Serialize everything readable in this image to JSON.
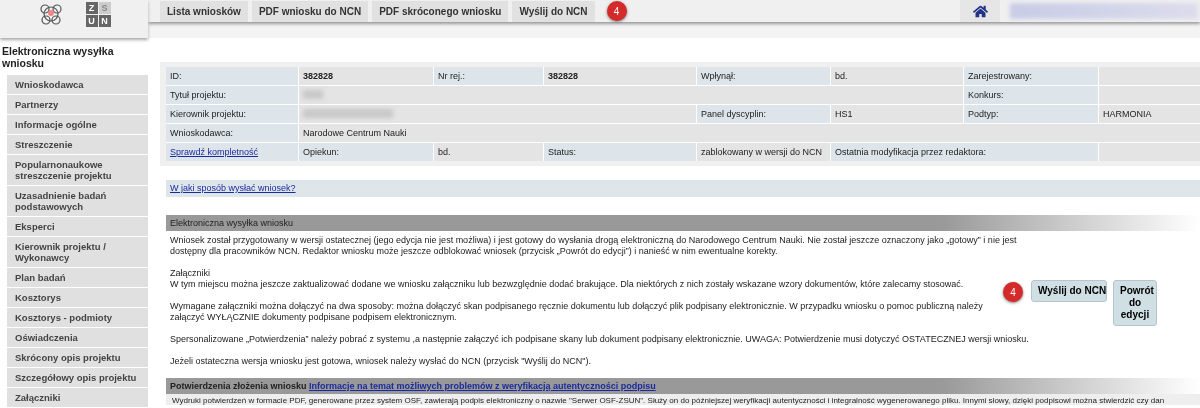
{
  "logo_letters": [
    "Z",
    "S",
    "U",
    "N"
  ],
  "top_tabs": [
    {
      "label": "Lista wniosków"
    },
    {
      "label": "PDF wniosku do NCN"
    },
    {
      "label": "PDF skróconego wniosku"
    },
    {
      "label": "Wyślij do NCN"
    }
  ],
  "top_badge": "4",
  "sidebar": {
    "title": "Elektroniczna wysyłka wniosku",
    "items": [
      "Wnioskodawca",
      "Partnerzy",
      "Informacje ogólne",
      "Streszczenie",
      "Popularnonaukowe streszczenie projektu",
      "Uzasadnienie badań podstawowych",
      "Eksperci",
      "Kierownik projektu / Wykonawcy",
      "Plan badań",
      "Kosztorys",
      "Kosztorys - podmioty",
      "Oświadczenia",
      "Skrócony opis projektu",
      "Szczegółowy opis projektu",
      "Załączniki"
    ]
  },
  "info_table": {
    "rows": [
      {
        "cells": [
          {
            "kind": "label",
            "text": "ID:"
          },
          {
            "kind": "value",
            "text": "382828",
            "bold": true
          },
          {
            "kind": "label",
            "text": "Nr rej.:"
          },
          {
            "kind": "value",
            "text": "382828",
            "bold": true
          },
          {
            "kind": "label",
            "text": "Wpłynął:"
          },
          {
            "kind": "value",
            "text": "bd."
          },
          {
            "kind": "label",
            "text": "Zarejestrowany:"
          },
          {
            "kind": "value"
          }
        ]
      },
      {
        "cells": [
          {
            "kind": "label",
            "text": "Tytuł projektu:"
          },
          {
            "kind": "redacted"
          },
          {
            "kind": "empty"
          },
          {
            "kind": "empty"
          },
          {
            "kind": "empty"
          },
          {
            "kind": "empty"
          },
          {
            "kind": "label",
            "text": "Konkurs:"
          },
          {
            "kind": "value"
          }
        ]
      },
      {
        "cells": [
          {
            "kind": "label",
            "text": "Kierownik projektu:"
          },
          {
            "kind": "redacted"
          },
          {
            "kind": "empty"
          },
          {
            "kind": "empty"
          },
          {
            "kind": "label",
            "text": "Panel dyscyplin:"
          },
          {
            "kind": "value",
            "text": "HS1"
          },
          {
            "kind": "label",
            "text": "Podtyp:"
          },
          {
            "kind": "value",
            "text": "HARMONIA"
          }
        ]
      },
      {
        "cells": [
          {
            "kind": "label",
            "text": "Wnioskodawca:"
          },
          {
            "kind": "value",
            "text": "Narodowe Centrum Nauki"
          },
          {
            "kind": "empty"
          },
          {
            "kind": "empty"
          },
          {
            "kind": "empty"
          },
          {
            "kind": "empty"
          },
          {
            "kind": "empty"
          },
          {
            "kind": "empty"
          }
        ]
      },
      {
        "cells": [
          {
            "kind": "link",
            "text": "Sprawdź kompletność"
          },
          {
            "kind": "label",
            "text": "Opiekun:"
          },
          {
            "kind": "value",
            "text": "bd."
          },
          {
            "kind": "label",
            "text": "Status:"
          },
          {
            "kind": "value",
            "text": "zablokowany w wersji do NCN"
          },
          {
            "kind": "label",
            "text": "Ostatnia modyfikacja przez redaktora:"
          },
          {
            "kind": "empty"
          },
          {
            "kind": "value"
          }
        ]
      }
    ]
  },
  "help_link": "W jaki sposób wysłać wniosek?",
  "send_section": {
    "title": "Elektroniczna wysyłka wniosku",
    "intro": "Wniosek został przygotowany w wersji ostatecznej (jego edycja nie jest możliwa) i jest gotowy do wysłania drogą elektroniczną do Narodowego Centrum Nauki. Nie został jeszcze oznaczony jako „gotowy” i nie jest dostępny dla pracowników NCN. Redaktor wniosku może jeszcze odblokować wniosek (przycisk „Powrót do edycji”) i nanieść w nim ewentualne korekty.",
    "attachments_title": "Załączniki",
    "attachments_text": "W tym miejscu można jeszcze zaktualizować dodane we wniosku załączniku lub bezwzględnie dodać brakujące. Dla niektórych z nich zostały wskazane wzory dokumentów, które zalecamy stosować.",
    "methods_text": "Wymagane załączniki można dołączyć na dwa sposoby: można dołączyć skan podpisanego ręcznie dokumentu lub dołączyć plik podpisany elektronicznie. W przypadku wniosku o pomoc publiczną należy załączyć WYŁĄCZNIE dokumenty podpisane podpisem elektronicznym.",
    "badge": "4",
    "buttons": [
      {
        "label": "Wyślij do NCN"
      },
      {
        "label": "Powrót do edycji"
      }
    ],
    "notes": [
      "Spersonalizowane „Potwierdzenia” należy pobrać z systemu ,a następnie załączyć ich podpisane skany lub dokument podpisany elektronicznie. UWAGA: Potwierdzenie musi dotyczyć OSTATECZNEJ wersji wniosku.",
      "Jeżeli ostateczna wersja wniosku jest gotowa, wniosek należy wysłać do NCN (przycisk \"Wyślij do NCN\")."
    ]
  },
  "confirm_section": {
    "title": "Potwierdzenia złożenia wniosku",
    "link": "Informacje na temat możliwych problemów z weryfikacją autentyczności podpisu",
    "text": "Wydruki potwierdzeń w formacie PDF, generowane przez system OSF, zawierają podpis elektroniczny o nazwie \"Serwer OSF-ZSUN\". Służy on do późniejszej weryfikacji autentyczności i integralność wygenerowanego pliku. Innymi słowy, dzięki podpisowi można stwierdzić czy dan"
  }
}
